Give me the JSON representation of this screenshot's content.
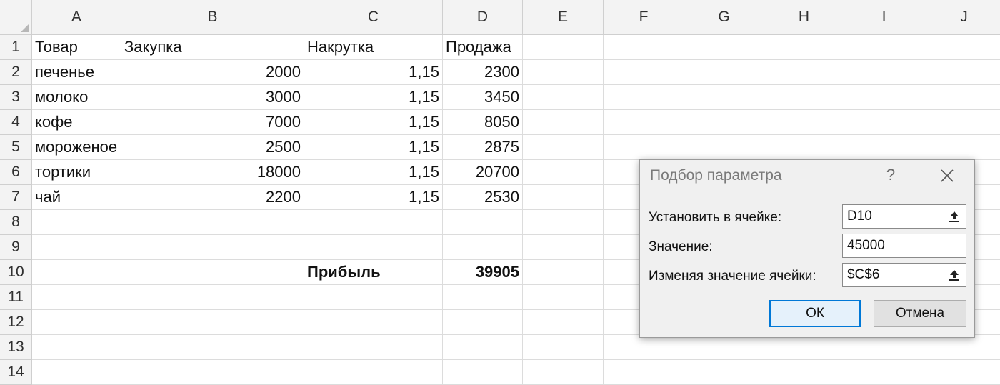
{
  "columns": [
    "A",
    "B",
    "C",
    "D",
    "E",
    "F",
    "G",
    "H",
    "I",
    "J"
  ],
  "rows": [
    "1",
    "2",
    "3",
    "4",
    "5",
    "6",
    "7",
    "8",
    "9",
    "10",
    "11",
    "12",
    "13",
    "14"
  ],
  "cells": {
    "A1": "Товар",
    "B1": "Закупка",
    "C1": "Накрутка",
    "D1": "Продажа",
    "A2": "печенье",
    "B2": "2000",
    "C2": "1,15",
    "D2": "2300",
    "A3": "молоко",
    "B3": "3000",
    "C3": "1,15",
    "D3": "3450",
    "A4": "кофе",
    "B4": "7000",
    "C4": "1,15",
    "D4": "8050",
    "A5": "мороженое",
    "B5": "2500",
    "C5": "1,15",
    "D5": "2875",
    "A6": "тортики",
    "B6": "18000",
    "C6": "1,15",
    "D6": "20700",
    "A7": "чай",
    "B7": "2200",
    "C7": "1,15",
    "D7": "2530",
    "C10": "Прибыль",
    "D10": "39905"
  },
  "dialog": {
    "title": "Подбор параметра",
    "help_label": "?",
    "set_cell_label": "Установить в ячейке:",
    "set_cell_value": "D10",
    "to_value_label": "Значение:",
    "to_value_value": "45000",
    "changing_cell_label": "Изменяя значение ячейки:",
    "changing_cell_value": "$C$6",
    "ok_label": "ОК",
    "cancel_label": "Отмена"
  }
}
